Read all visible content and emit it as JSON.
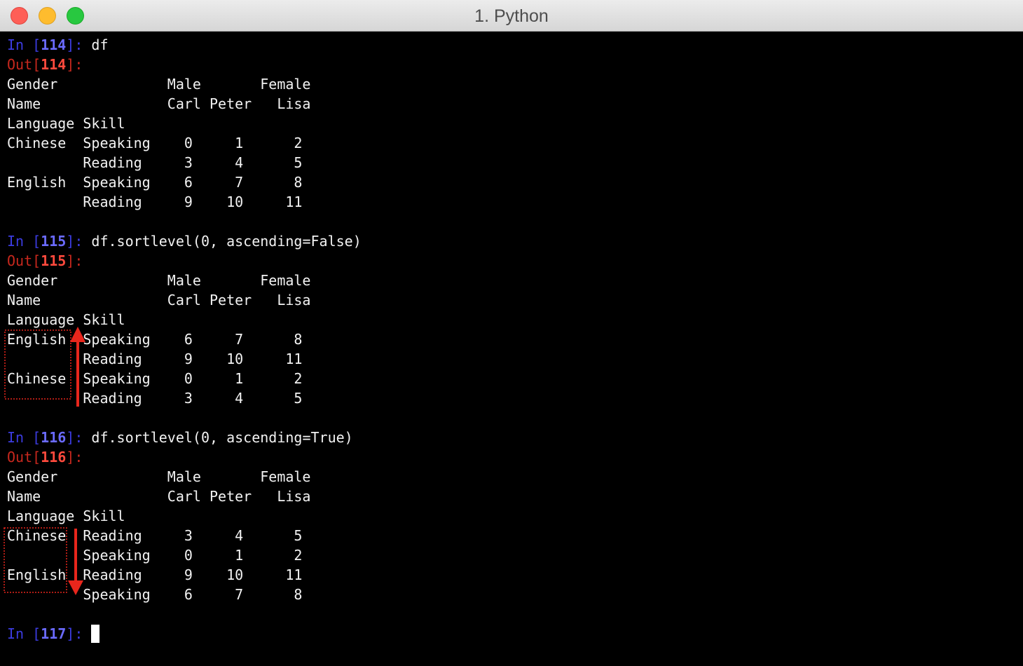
{
  "window": {
    "title": "1. Python"
  },
  "colors": {
    "in_prompt": "#3c3ce0",
    "out_prompt": "#c8281e",
    "annotation": "#e8261c",
    "text": "#f2f2f2"
  },
  "icons": {
    "close": "close-button-dot",
    "minimize": "minimize-button-dot",
    "zoom": "zoom-button-dot"
  },
  "cells": [
    {
      "in_label": "In ",
      "out_label": "Out",
      "number": "114",
      "code": "df",
      "output": [
        "Gender             Male       Female",
        "Name               Carl Peter   Lisa",
        "Language Skill",
        "Chinese  Speaking    0     1      2",
        "         Reading     3     4      5",
        "English  Speaking    6     7      8",
        "         Reading     9    10     11"
      ]
    },
    {
      "in_label": "In ",
      "out_label": "Out",
      "number": "115",
      "code": "df.sortlevel(0, ascending=False)",
      "output": [
        "Gender             Male       Female",
        "Name               Carl Peter   Lisa",
        "Language Skill",
        "English  Speaking    6     7      8",
        "         Reading     9    10     11",
        "Chinese  Speaking    0     1      2",
        "         Reading     3     4      5"
      ]
    },
    {
      "in_label": "In ",
      "out_label": "Out",
      "number": "116",
      "code": "df.sortlevel(0, ascending=True)",
      "output": [
        "Gender             Male       Female",
        "Name               Carl Peter   Lisa",
        "Language Skill",
        "Chinese  Reading     3     4      5",
        "         Speaking    0     1      2",
        "English  Reading     9    10     11",
        "         Speaking    6     7      8"
      ]
    }
  ],
  "final_prompt": {
    "in_label": "In ",
    "number": "117"
  },
  "annotations": [
    {
      "name": "descending-arrow",
      "direction": "up",
      "color": "#e8261c"
    },
    {
      "name": "ascending-arrow",
      "direction": "down",
      "color": "#e8261c"
    }
  ]
}
